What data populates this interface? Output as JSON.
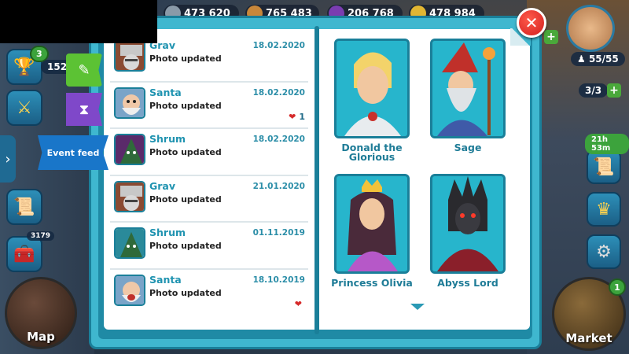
{
  "resources": [
    {
      "value": "473 620",
      "color": "#8a9aa8"
    },
    {
      "value": "765 483",
      "color": "#c8873a"
    },
    {
      "value": "206 768",
      "color": "#7a3db0"
    },
    {
      "value": "478 984",
      "color": "#e2b632"
    }
  ],
  "left_hud": {
    "trophy_badge": "3",
    "trophy_count": "1525",
    "chest_count": "3179",
    "map_label": "Map"
  },
  "tabs": {
    "event_feed_label": "Event feed"
  },
  "feed": [
    {
      "name": "Grav",
      "message": "Photo updated",
      "date": "18.02.2020",
      "likes": "",
      "avatar": "grav"
    },
    {
      "name": "Santa",
      "message": "Photo updated",
      "date": "18.02.2020",
      "likes": "1",
      "avatar": "santa"
    },
    {
      "name": "Shrum",
      "message": "Photo updated",
      "date": "18.02.2020",
      "likes": "",
      "avatar": "shrum"
    },
    {
      "name": "Grav",
      "message": "Photo updated",
      "date": "21.01.2020",
      "likes": "",
      "avatar": "grav"
    },
    {
      "name": "Shrum",
      "message": "Photo updated",
      "date": "01.11.2019",
      "likes": "",
      "avatar": "shrum"
    },
    {
      "name": "Santa",
      "message": "Photo updated",
      "date": "18.10.2019",
      "likes": "",
      "avatar": "santa"
    }
  ],
  "cards": [
    {
      "name": "Donald the Glorious",
      "portrait": "knight"
    },
    {
      "name": "Sage",
      "portrait": "wizard"
    },
    {
      "name": "Princess Olivia",
      "portrait": "princess"
    },
    {
      "name": "Abyss Lord",
      "portrait": "demon"
    }
  ],
  "right_hud": {
    "population": "55/55",
    "slots": "3/3",
    "timer": "21h 53m",
    "market_label": "Market",
    "market_badge": "1"
  }
}
